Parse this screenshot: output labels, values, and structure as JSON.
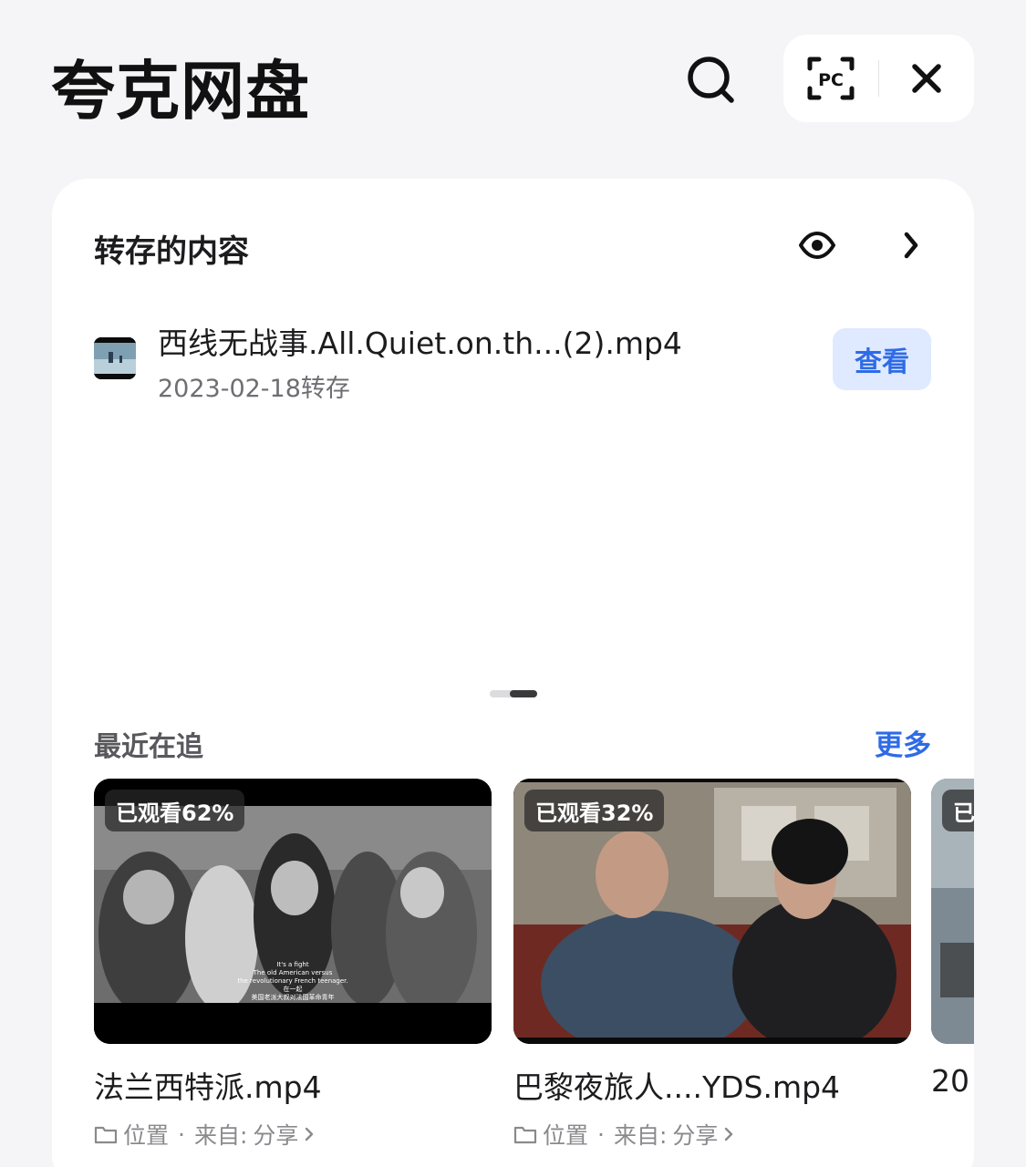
{
  "header": {
    "title": "夸克网盘",
    "pc_label": "PC"
  },
  "saved": {
    "title": "转存的内容",
    "file": {
      "name": "西线无战事.All.Quiet.on.th...(2).mp4",
      "date": "2023-02-18转存",
      "view_label": "查看"
    }
  },
  "recent": {
    "title": "最近在追",
    "more_label": "更多",
    "items": [
      {
        "progress": "已观看62%",
        "name": "法兰西特派.mp4",
        "location": "位置",
        "source_label": "来自:",
        "source": "分享",
        "subtitle_lines": [
          "It's a fight",
          "The old American versus",
          "the revolutionary French teenager.",
          "在一起",
          "美国老派大叔对法国革命青年"
        ]
      },
      {
        "progress": "已观看32%",
        "name": "巴黎夜旅人....YDS.mp4",
        "location": "位置",
        "source_label": "来自:",
        "source": "分享"
      },
      {
        "progress": "已",
        "name": "20"
      }
    ]
  },
  "colors": {
    "accent": "#2e6be6",
    "accent_bg": "#dfe9ff",
    "page_bg": "#f5f5f7"
  }
}
